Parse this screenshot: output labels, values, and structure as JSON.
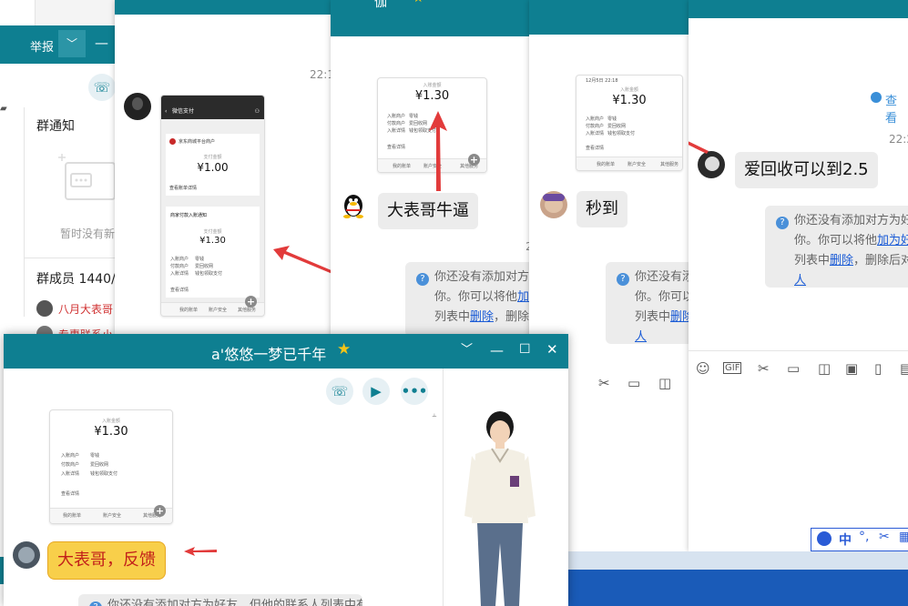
{
  "left_panel": {
    "report_label": "举报",
    "group_notice_title": "群通知",
    "empty_text": "暂时没有新",
    "members_title": "群成员 1440/",
    "member_1": "八月大表哥",
    "member_2": "专惠联系小"
  },
  "win2": {
    "time": "22:1",
    "card": {
      "header": "微信支付",
      "merchant": "京东商城平台商户",
      "label_amount": "支付金额",
      "amount_1": "¥1.00",
      "detail_link": "查看账单详情",
      "notice_title": "商家付款入账通知",
      "amount_2": "¥1.30",
      "row1_k": "入账商户",
      "row1_v": "零钱",
      "row2_k": "付款商户",
      "row2_v": "爱回收网",
      "row3_k": "入账详情",
      "row3_v": "钱包领取支付",
      "detail_2": "查看详情",
      "foot_1": "我的账单",
      "foot_2": "账户安全",
      "foot_3": "其他服务"
    }
  },
  "win3": {
    "title": "伽",
    "thumb_amount": "¥1.30",
    "thumb_amount_label": "入账金额",
    "row1_k": "入账商户",
    "row1_v": "零钱",
    "row2_k": "付款商户",
    "row2_v": "爱回收网",
    "row3_k": "入账详情",
    "row3_v": "钱包领取支付",
    "detail": "查看详情",
    "foot_1": "我的账单",
    "foot_2": "账户安全",
    "foot_3": "其他服务",
    "bubble": "大表哥牛逼",
    "sys_line1": "你还没有添加对方为",
    "sys_line2": "你。你可以将他",
    "sys_link1": "加为",
    "sys_line3": "列表中",
    "sys_link2": "删除",
    "sys_line3b": "，删除后",
    "time": "22"
  },
  "win4": {
    "thumb_amount": "¥1.30",
    "thumb_amount_label": "入账金额",
    "thumb_time": "12月5日 22:18",
    "row1_k": "入账商户",
    "row1_v": "零钱",
    "row2_k": "付款商户",
    "row2_v": "爱回收网",
    "row3_k": "入账详情",
    "row3_v": "钱包领取支付",
    "detail": "查看详情",
    "foot_1": "我的账单",
    "foot_2": "账户安全",
    "foot_3": "其他服务",
    "bubble": "秒到",
    "sys_line1": "你还没有添",
    "sys_line2": "你。你可以",
    "sys_line3": "列表中",
    "sys_link1": "删除",
    "sys_line4": "人"
  },
  "win5": {
    "view_link": "查看",
    "time": "22:2",
    "bubble": "爱回收可以到2.5",
    "sys_line1": "你还没有添加对方为好友",
    "sys_line2": "你。你可以将他",
    "sys_link1": "加为好友",
    "sys_line3": "列表中",
    "sys_link2": "删除",
    "sys_line3b": "，删除后对",
    "sys_line4": "人",
    "ime": "中"
  },
  "win_main": {
    "title": "a'悠悠一梦已千年",
    "thumb_amount": "¥1.30",
    "thumb_amount_label": "入账金额",
    "row1_k": "入账商户",
    "row1_v": "零钱",
    "row2_k": "付款商户",
    "row2_v": "爱回收网",
    "row3_k": "入账详情",
    "row3_v": "钱包领取支付",
    "detail": "查看详情",
    "foot_1": "我的账单",
    "foot_2": "账户安全",
    "foot_3": "其他服务",
    "bubble": "大表哥，反馈",
    "sys_bottom": "你还没有添加对方为好友，但他的联系人列表中有"
  },
  "colors": {
    "titlebar": "#0e7f91",
    "arrow": "#e23b3b",
    "bubble_gold": "#f8cf4a",
    "link": "#1a5bd6"
  }
}
